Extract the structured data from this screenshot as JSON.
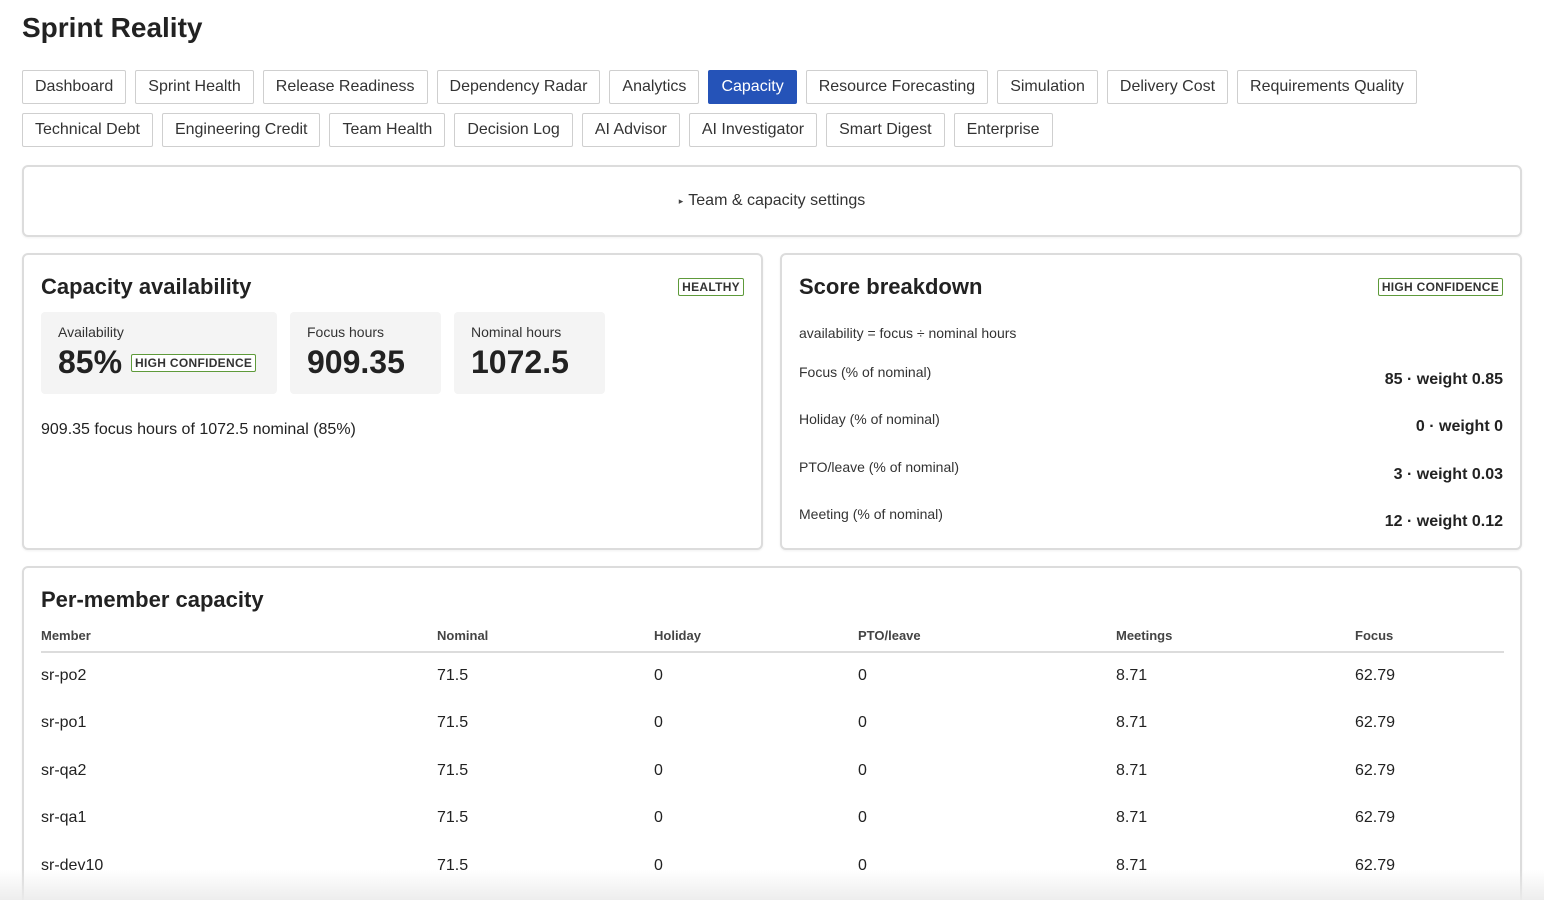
{
  "app": {
    "title": "Sprint Reality"
  },
  "tabs": {
    "row1": [
      "Dashboard",
      "Sprint Health",
      "Release Readiness",
      "Dependency Radar",
      "Analytics",
      "Capacity",
      "Resource Forecasting",
      "Simulation",
      "Delivery Cost",
      "Requirements Quality"
    ],
    "row2": [
      "Technical Debt",
      "Engineering Credit",
      "Team Health",
      "Decision Log",
      "AI Advisor",
      "AI Investigator",
      "Smart Digest",
      "Enterprise"
    ],
    "active": "Capacity"
  },
  "settings": {
    "label": "Team & capacity settings"
  },
  "capacity": {
    "title": "Capacity availability",
    "status_badge": "HEALTHY",
    "availability": {
      "label": "Availability",
      "value": "85%",
      "badge": "HIGH CONFIDENCE"
    },
    "focus": {
      "label": "Focus hours",
      "value": "909.35"
    },
    "nominal": {
      "label": "Nominal hours",
      "value": "1072.5"
    },
    "summary": "909.35 focus hours of 1072.5 nominal (85%)"
  },
  "score": {
    "title": "Score breakdown",
    "badge": "HIGH CONFIDENCE",
    "formula": "availability = focus ÷ nominal hours",
    "rows": [
      {
        "label": "Focus (% of nominal)",
        "value": "85 · weight 0.85"
      },
      {
        "label": "Holiday (% of nominal)",
        "value": "0 · weight 0"
      },
      {
        "label": "PTO/leave (% of nominal)",
        "value": "3 · weight 0.03"
      },
      {
        "label": "Meeting (% of nominal)",
        "value": "12 · weight 0.12"
      }
    ]
  },
  "members": {
    "title": "Per-member capacity",
    "columns": [
      "Member",
      "Nominal",
      "Holiday",
      "PTO/leave",
      "Meetings",
      "Focus"
    ],
    "rows": [
      [
        "sr-po2",
        "71.5",
        "0",
        "0",
        "8.71",
        "62.79"
      ],
      [
        "sr-po1",
        "71.5",
        "0",
        "0",
        "8.71",
        "62.79"
      ],
      [
        "sr-qa2",
        "71.5",
        "0",
        "0",
        "8.71",
        "62.79"
      ],
      [
        "sr-qa1",
        "71.5",
        "0",
        "0",
        "8.71",
        "62.79"
      ],
      [
        "sr-dev10",
        "71.5",
        "0",
        "0",
        "8.71",
        "62.79"
      ]
    ]
  },
  "colors": {
    "accent": "#2553b8",
    "badge_border": "#5e9a3a",
    "metric_bg": "#f4f4f4",
    "border": "#dcdcdc"
  }
}
